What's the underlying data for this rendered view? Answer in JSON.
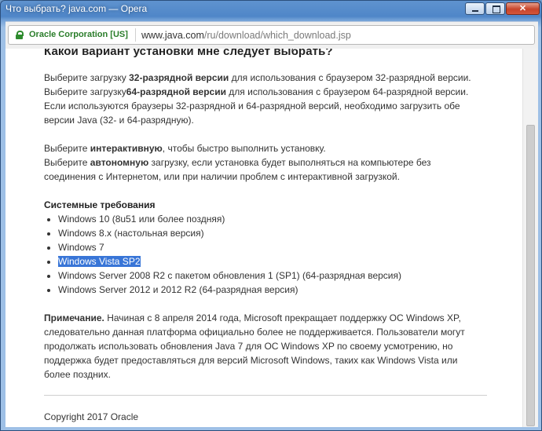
{
  "window": {
    "title": "Что выбрать? java.com — Opera",
    "minimize": "minimize",
    "maximize": "maximize",
    "close": "✕"
  },
  "address": {
    "cert_owner": "Oracle Corporation [US]",
    "url_host": "www.java.com",
    "url_path": "/ru/download/which_download.jsp",
    "lock_color": "#2e8b2e"
  },
  "page": {
    "heading": "Какой вариант установки мне следует выбрать?",
    "para1": {
      "s1_pre": "Выберите загрузку ",
      "s1_bold": "32-разрядной версии",
      "s1_post": " для использования с браузером 32-разрядной версии.",
      "s2_pre": "Выберите загрузку",
      "s2_bold": "64-разрядной версии",
      "s2_post": " для использования с браузером 64-разрядной версии.",
      "s3_line1": "Если используются браузеры 32-разрядной и 64-разрядной версий, необходимо загрузить обе",
      "s3_line2": "версии Java (32- и 64-разрядную)."
    },
    "para2": {
      "s1_pre": "Выберите ",
      "s1_bold": "интерактивную",
      "s1_post": ", чтобы быстро выполнить установку.",
      "s2_pre": "Выберите ",
      "s2_bold": "автономную",
      "s2_post": " загрузку, если установка будет выполняться на компьютере без",
      "s2_line2": "соединения с Интернетом, или при наличии проблем с интерактивной загрузкой."
    },
    "requirements_title": "Системные требования",
    "requirements": [
      "Windows 10 (8u51 или более поздняя)",
      "Windows 8.x (настольная версия)",
      "Windows 7",
      "Windows Vista SP2",
      "Windows Server 2008 R2 с пакетом обновления 1 (SP1) (64-разрядная версия)",
      "Windows Server 2012 и 2012 R2 (64-разрядная версия)"
    ],
    "note": {
      "label": "Примечание.",
      "line1": " Начиная с 8 апреля 2014 года, Microsoft прекращает поддержку ОС Windows XP,",
      "line2": "следовательно данная платформа официально более не поддерживается. Пользователи могут",
      "line3": "продолжать использовать обновления Java 7 для ОС Windows XP по своему усмотрению, но",
      "line4": "поддержка будет предоставляться для версий Microsoft Windows, таких как Windows Vista или",
      "line5": "более поздних."
    },
    "footer": "Copyright 2017 Oracle"
  }
}
